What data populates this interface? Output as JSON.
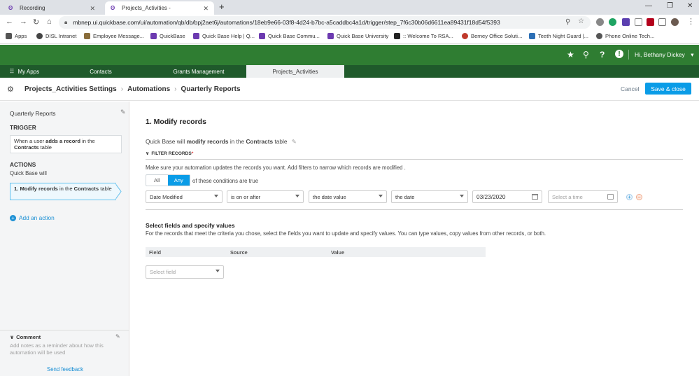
{
  "browser": {
    "tabs": [
      {
        "label": "Recording"
      },
      {
        "label": "Projects_Activities -"
      }
    ],
    "new_tab": "+",
    "url": "mbnep.ui.quickbase.com/ui/automation/qb/db/bpj2aet6j/automations/18eb9e66-03f8-4d24-b7bc-a5caddbc4a1d/trigger/step_7f6c30b06d6611ea89431f18d54f5393",
    "bookmarks": [
      {
        "label": "Apps",
        "color": "#555555"
      },
      {
        "label": "DISL Intranet",
        "color": "#444444"
      },
      {
        "label": "Employee Message...",
        "color": "#8a6d3b"
      },
      {
        "label": "QuickBase",
        "color": "#6c3ab0"
      },
      {
        "label": "Quick Base Help | Q...",
        "color": "#6c3ab0"
      },
      {
        "label": "Quick Base Commu...",
        "color": "#6c3ab0"
      },
      {
        "label": "Quick Base University",
        "color": "#6c3ab0"
      },
      {
        "label": ":: Welcome To RSA...",
        "color": "#222222"
      },
      {
        "label": "Berney Office Soluti...",
        "color": "#c0392b"
      },
      {
        "label": "Teeth Night Guard |...",
        "color": "#2c6fb5"
      },
      {
        "label": "Phone Online Tech...",
        "color": "#555555"
      }
    ]
  },
  "header": {
    "user": "Hi, Bethany Dickey",
    "user_icon": "chevron-down-icon"
  },
  "app_tabs": [
    {
      "label": "My Apps"
    },
    {
      "label": "Contacts"
    },
    {
      "label": "Grants Management"
    },
    {
      "label": "Projects_Activities"
    }
  ],
  "settings_bar": {
    "crumb1": "Projects_Activities Settings",
    "crumb2": "Automations",
    "crumb3": "Quarterly Reports",
    "sep": "›",
    "cancel": "Cancel",
    "save": "Save & close"
  },
  "sidebar": {
    "title": "Quarterly Reports",
    "trigger_heading": "TRIGGER",
    "trigger_card": {
      "pre": "When a user ",
      "bold1": "adds a record",
      "mid": " in the ",
      "bold2": "Contracts",
      "post": " table"
    },
    "actions_heading": "ACTIONS",
    "actions_sub": "Quick Base will",
    "action_card": {
      "bold1": "1. Modify records",
      "mid": " in the ",
      "bold2": "Contracts",
      "post": " table"
    },
    "add_action": "Add an action",
    "comment_heading": "Comment",
    "comment_placeholder": "Add notes as a reminder about how this automation will be used",
    "feedback": "Send feedback"
  },
  "main": {
    "step_title": "1. Modify records",
    "desc": {
      "pre": "Quick Base will ",
      "bold1": "modify records",
      "mid": " in the ",
      "bold2": "Contracts",
      "post": " table"
    },
    "filter_label": "FILTER RECORDS",
    "filter_required": "*",
    "filter_help": "Make sure your automation updates the records you want. Add filters to narrow which records are modified .",
    "toggle_all": "All",
    "toggle_any": "Any",
    "conditions_suffix": "of these conditions are true",
    "condition": {
      "field": "Date Modified",
      "operator": "is on or after",
      "value_type": "the date value",
      "date_kind": "the date",
      "date_value": "03/23/2020",
      "time_placeholder": "Select a time"
    },
    "section2_title": "Select fields and specify values",
    "section2_help": "For the records that meet the criteria you chose, select the fields you want to update and specify values. You can type values, copy values from other records, or both.",
    "table_headers": [
      "Field",
      "Source",
      "Value"
    ],
    "select_field_placeholder": "Select field"
  },
  "colors": {
    "green_header": "#2f7d32",
    "dark_green_tabs": "#1f5a2b",
    "accent_blue": "#0a9ce7",
    "purple": "#6c3ab0"
  }
}
